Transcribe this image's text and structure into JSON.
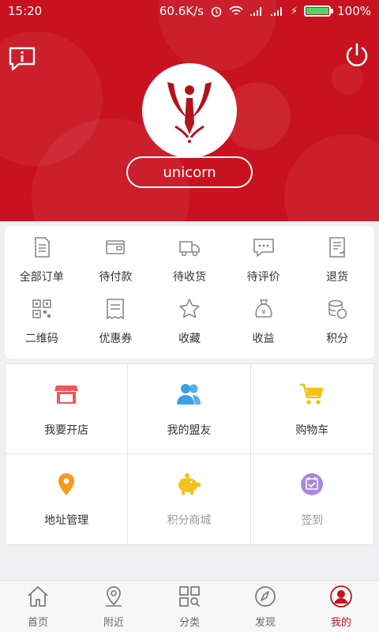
{
  "status_bar": {
    "time": "15:20",
    "speed": "60.6K/s",
    "battery": "100%",
    "battery_level": 1.0
  },
  "user": {
    "name": "unicorn"
  },
  "orders": [
    {
      "label": "全部订单",
      "icon": "document-icon"
    },
    {
      "label": "待付款",
      "icon": "wallet-icon"
    },
    {
      "label": "待收货",
      "icon": "truck-icon"
    },
    {
      "label": "待评价",
      "icon": "comment-icon"
    },
    {
      "label": "退货",
      "icon": "return-icon"
    },
    {
      "label": "二维码",
      "icon": "qrcode-icon"
    },
    {
      "label": "优惠券",
      "icon": "coupon-icon"
    },
    {
      "label": "收藏",
      "icon": "star-icon"
    },
    {
      "label": "收益",
      "icon": "money-bag-icon"
    },
    {
      "label": "积分",
      "icon": "coins-icon"
    }
  ],
  "functions": [
    {
      "label": "我要开店",
      "icon": "shop-icon",
      "color": "#f0565b"
    },
    {
      "label": "我的盟友",
      "icon": "friends-icon",
      "color": "#3aa0e8"
    },
    {
      "label": "购物车",
      "icon": "cart-icon",
      "color": "#f5c21b"
    },
    {
      "label": "地址管理",
      "icon": "location-icon",
      "color": "#f59a1b"
    },
    {
      "label": "积分商城",
      "icon": "piggy-bank-icon",
      "color": "#f5c21b"
    },
    {
      "label": "签到",
      "icon": "checkin-icon",
      "color": "#a989e0"
    }
  ],
  "nav": [
    {
      "label": "首页",
      "icon": "home-icon"
    },
    {
      "label": "附近",
      "icon": "nearby-icon"
    },
    {
      "label": "分类",
      "icon": "category-icon"
    },
    {
      "label": "发现",
      "icon": "discover-icon"
    },
    {
      "label": "我的",
      "icon": "profile-icon",
      "active": true
    }
  ],
  "colors": {
    "brand": "#c8121f"
  }
}
